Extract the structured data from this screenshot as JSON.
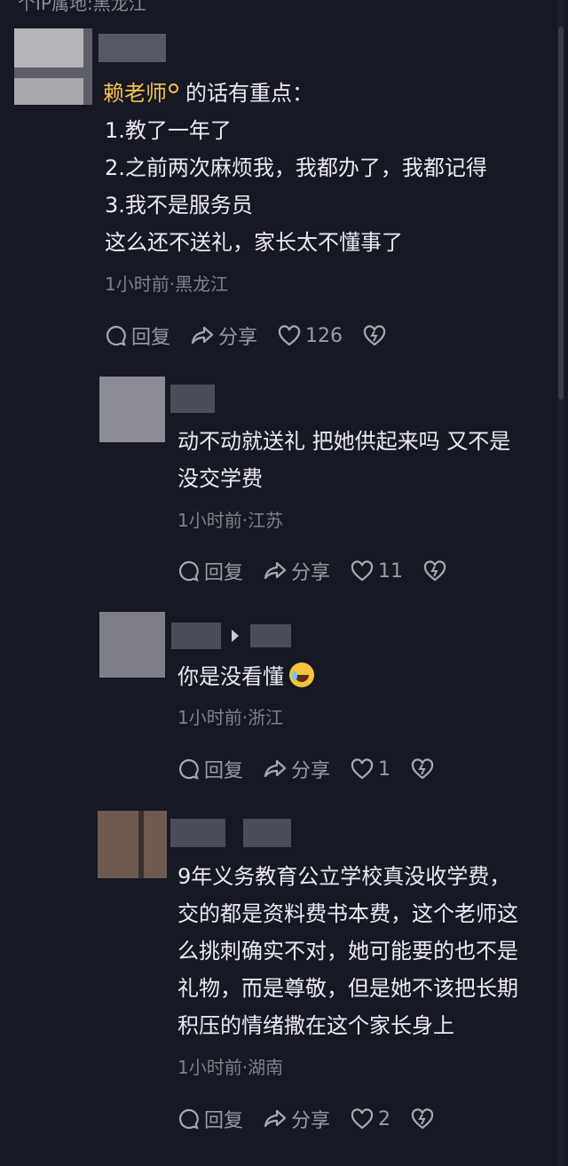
{
  "top_text": "个IP属地:黑龙江",
  "comments": [
    {
      "author_tag": "赖老师",
      "lines": [
        "的话有重点：",
        "1.教了一年了",
        "2.之前两次麻烦我，我都办了，我都记得",
        "3.我不是服务员",
        "这么还不送礼，家长太不懂事了"
      ],
      "meta": "1小时前·黑龙江",
      "reply_label": "回复",
      "share_label": "分享",
      "likes": "126"
    },
    {
      "lines": [
        "动不动就送礼 把她供起来吗 又不是",
        "没交学费"
      ],
      "meta": "1小时前·江苏",
      "reply_label": "回复",
      "share_label": "分享",
      "likes": "11"
    },
    {
      "lines": [
        "你是没看懂"
      ],
      "meta": "1小时前·浙江",
      "reply_label": "回复",
      "share_label": "分享",
      "likes": "1"
    },
    {
      "lines": [
        "9年义务教育公立学校真没收学费，",
        "交的都是资料费书本费，这个老师这",
        "么挑刺确实不对，她可能要的也不是",
        "礼物，而是尊敬，但是她不该把长期",
        "积压的情绪撒在这个家长身上"
      ],
      "meta": "1小时前·湖南",
      "reply_label": "回复",
      "share_label": "分享",
      "likes": "2"
    }
  ],
  "colors": {
    "background": "#161823",
    "author_tag": "#f3c24c",
    "meta": "#80818a"
  },
  "icons": [
    "comment-bubble-icon",
    "share-arrow-icon",
    "heart-icon",
    "broken-heart-icon",
    "laughing-crying-emoji-icon"
  ]
}
